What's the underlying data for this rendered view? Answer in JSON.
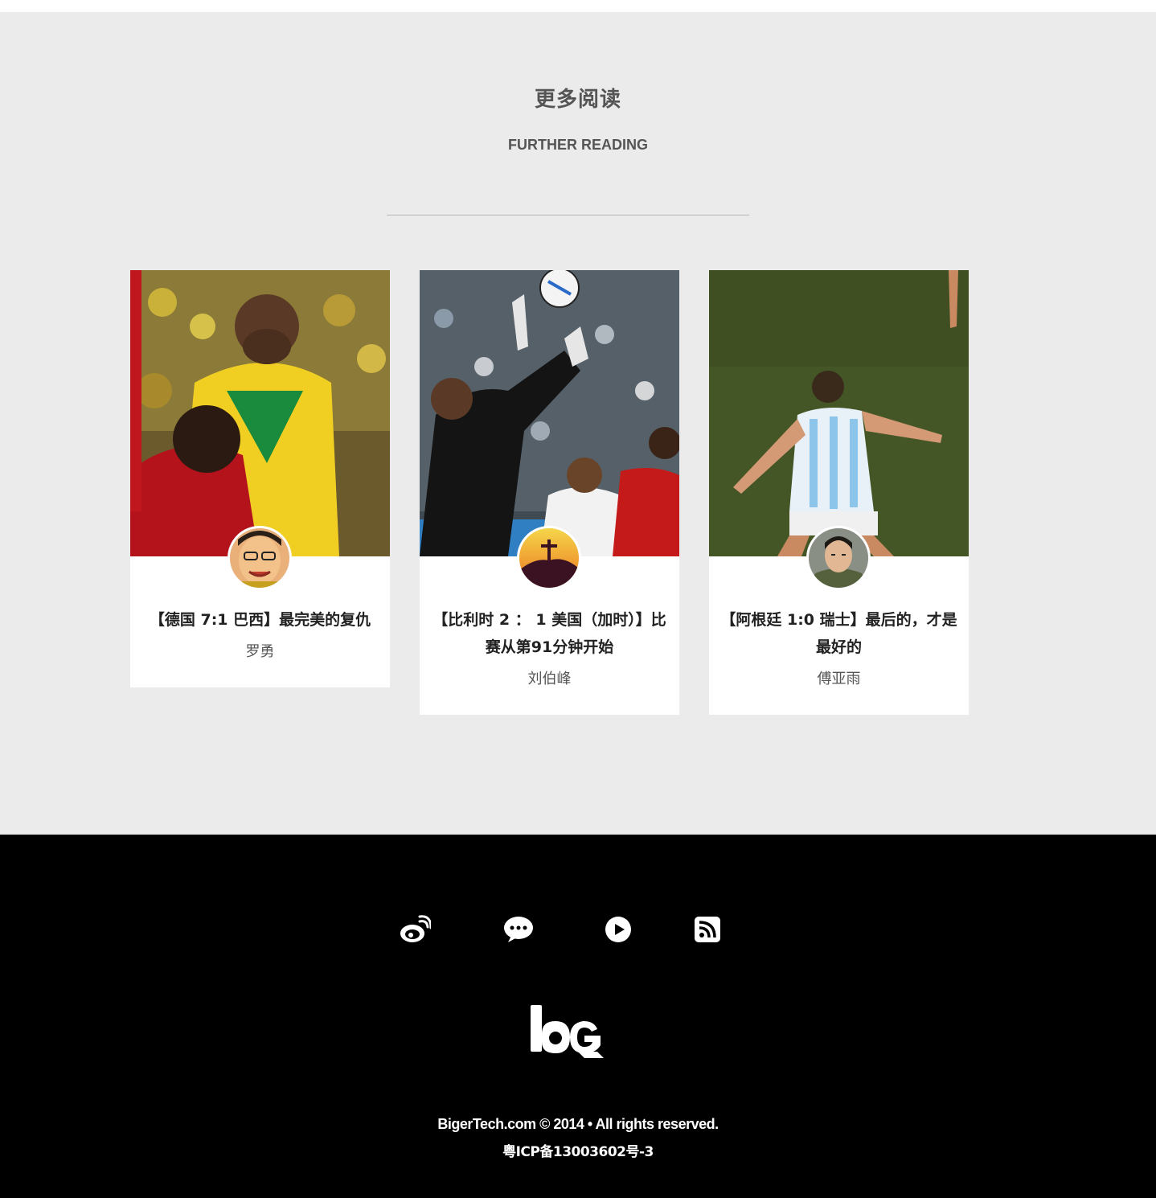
{
  "further_reading": {
    "title": "更多阅读",
    "subtitle": "FURTHER READING",
    "cards": [
      {
        "title": "【德国 7:1 巴西】最完美的复仇",
        "author": "罗勇",
        "image_icon": "soccer-photo-brazil-colombia",
        "avatar_icon": "author-avatar-cartoon"
      },
      {
        "title": "【比利时 2 ： 1 美国（加时）】比赛从第91分钟开始",
        "author": "刘伯峰",
        "image_icon": "soccer-photo-goalkeeper-save",
        "avatar_icon": "author-avatar-christ-redeemer"
      },
      {
        "title": "【阿根廷 1:0 瑞士】最后的，才是最好的",
        "author": "傅亚雨",
        "image_icon": "soccer-photo-argentina-player",
        "avatar_icon": "author-avatar-photo"
      }
    ]
  },
  "footer": {
    "social": [
      {
        "icon": "weibo-icon"
      },
      {
        "icon": "wechat-icon"
      },
      {
        "icon": "video-play-icon"
      },
      {
        "icon": "rss-icon"
      }
    ],
    "copyright": "BigerTech.com © 2014 • All rights reserved.",
    "icp": "粤ICP备13003602号-3"
  },
  "colors": {
    "section_background": "#ebebeb",
    "footer_background": "#000000",
    "heading_text": "#555555",
    "card_background": "#ffffff"
  }
}
